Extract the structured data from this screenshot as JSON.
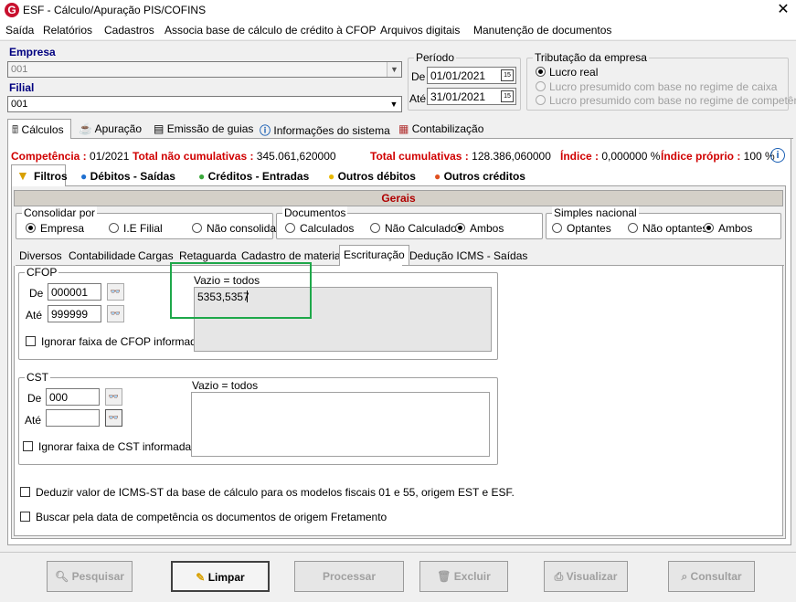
{
  "window": {
    "title": "ESF - Cálculo/Apuração PIS/COFINS",
    "close_glyph": "✕",
    "icon_letter": "G"
  },
  "menu": [
    "Saída",
    "Relatórios",
    "Cadastros",
    "Associa base de cálculo de crédito à CFOP",
    "Arquivos digitais",
    "Manutenção de documentos"
  ],
  "empresa": {
    "label": "Empresa",
    "value": "001"
  },
  "filial": {
    "label": "Filial",
    "value": "001"
  },
  "periodo": {
    "label": "Período",
    "de_label": "De",
    "de_value": "01/01/2021",
    "ate_label": "Até",
    "ate_value": "31/01/2021",
    "cal_glyph": "15"
  },
  "tributacao": {
    "label": "Tributação da empresa",
    "options": [
      "Lucro real",
      "Lucro presumido com base no regime de caixa",
      "Lucro presumido com base no regime de competência"
    ],
    "selected": 0
  },
  "main_tabs": [
    "Cálculos",
    "Apuração",
    "Emissão de guias",
    "Informações do sistema",
    "Contabilização"
  ],
  "status": {
    "competencia_label": "Competência :",
    "competencia_value": " 01/2021",
    "nao_cum_label": "Total não cumulativas :",
    "nao_cum_value": " 345.061,620000",
    "cum_label": "Total cumulativas :",
    "cum_value": " 128.386,060000",
    "indice_label": "Índice :",
    "indice_value": " 0,000000 %",
    "indice_proprio_label": "Índice próprio :",
    "indice_proprio_value": " 100 %"
  },
  "sub_tabs": [
    "Filtros",
    "Débitos - Saídas",
    "Créditos - Entradas",
    "Outros débitos",
    "Outros créditos"
  ],
  "gerais": {
    "header": "Gerais"
  },
  "consolidar": {
    "label": "Consolidar por",
    "options": [
      "Empresa",
      "I.E Filial",
      "Não consolidar"
    ],
    "selected": 0
  },
  "documentos": {
    "label": "Documentos",
    "options": [
      "Calculados",
      "Não Calculados",
      "Ambos"
    ],
    "selected": 2
  },
  "simples": {
    "label": "Simples nacional",
    "options": [
      "Optantes",
      "Não optantes",
      "Ambos"
    ],
    "selected": 2
  },
  "inner_tabs": [
    "Diversos",
    "Contabilidade",
    "Cargas",
    "Retaguarda",
    "Cadastro de materiais",
    "Escrituração",
    "Dedução ICMS - Saídas"
  ],
  "inner_tab_active": 5,
  "cfop": {
    "label": "CFOP",
    "de_label": "De",
    "de_value": "000001",
    "ate_label": "Até",
    "ate_value": "999999",
    "ignorar_label": "Ignorar faixa de CFOP informada",
    "vazio_label": "Vazio = todos",
    "list_value": "5353,5357"
  },
  "cst": {
    "label": "CST",
    "de_label": "De",
    "de_value": "000",
    "ate_label": "Até",
    "ate_value": "",
    "ignorar_label": "Ignorar faixa de CST informada",
    "vazio_label": "Vazio = todos",
    "list_value": ""
  },
  "checks": {
    "deduzir": "Deduzir valor de ICMS-ST da base de cálculo para os modelos fiscais 01 e 55, origem EST e ESF.",
    "buscar": "Buscar pela data de competência os documentos de origem Fretamento"
  },
  "buttons": {
    "pesquisar": "Pesquisar",
    "limpar": "Limpar",
    "processar": "Processar",
    "excluir": "Excluir",
    "visualizar": "Visualizar",
    "consultar": "Consultar"
  },
  "colors": {
    "highlight_box": "#1ea84a",
    "status_red": "#d00000",
    "label_navy": "#000080",
    "gerais_header": "#b00000"
  }
}
